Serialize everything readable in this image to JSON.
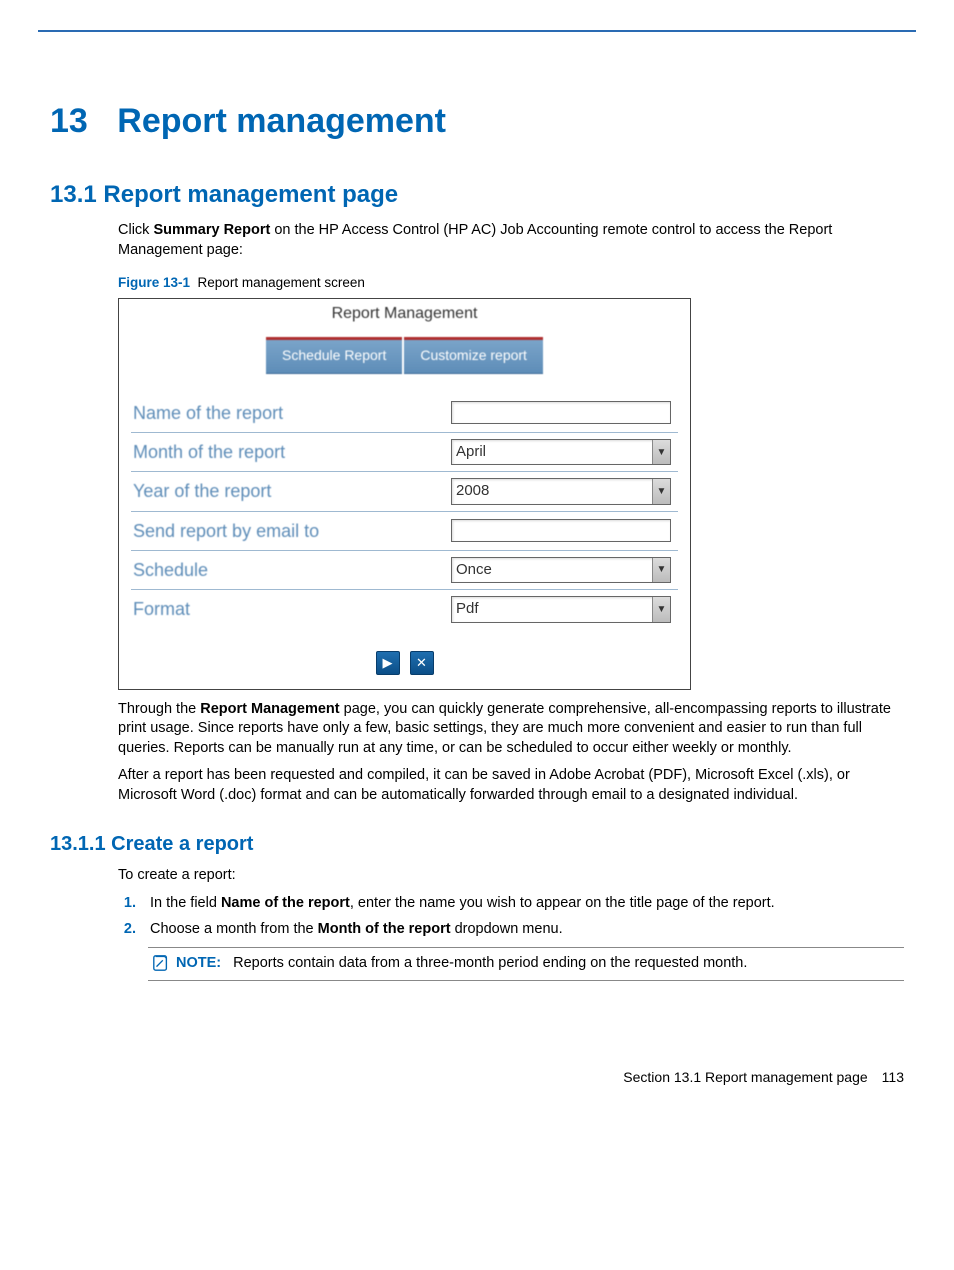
{
  "chapter": {
    "number": "13",
    "title": "Report management"
  },
  "section": {
    "number": "13.1",
    "title": "Report management page"
  },
  "intro": {
    "pre": "Click ",
    "bold": "Summary Report",
    "post": " on the HP Access Control (HP AC) Job Accounting remote control to access the Report Management page:"
  },
  "figure": {
    "label": "Figure 13-1",
    "caption": "Report management screen"
  },
  "screenshot": {
    "title": "Report Management",
    "tabs": {
      "schedule": "Schedule Report",
      "customize": "Customize report"
    },
    "rows": {
      "name_label": "Name of the report",
      "name_value": "",
      "month_label": "Month of the report",
      "month_value": "April",
      "year_label": "Year of the report",
      "year_value": "2008",
      "email_label": "Send report by email to",
      "email_value": "",
      "schedule_label": "Schedule",
      "schedule_value": "Once",
      "format_label": "Format",
      "format_value": "Pdf"
    }
  },
  "paras": {
    "p1_pre": "Through the ",
    "p1_bold": "Report Management",
    "p1_post": " page, you can quickly generate comprehensive, all-encompassing reports to illustrate print usage. Since reports have only a few, basic settings, they are much more convenient and easier to run than full queries. Reports can be manually run at any time, or can be scheduled to occur either weekly or monthly.",
    "p2": "After a report has been requested and compiled, it can be saved in Adobe Acrobat (PDF), Microsoft Excel (.xls), or Microsoft Word (.doc) format and can be automatically forwarded through email to a designated individual."
  },
  "subsection": {
    "number": "13.1.1",
    "title": "Create a report"
  },
  "create_intro": "To create a report:",
  "steps": {
    "s1_pre": "In the field ",
    "s1_bold": "Name of the report",
    "s1_post": ", enter the name you wish to appear on the title page of the report.",
    "s2_pre": "Choose a month from the ",
    "s2_bold": "Month of the report",
    "s2_post": " dropdown menu."
  },
  "note": {
    "label": "NOTE:",
    "text": "Reports contain data from a three-month period ending on the requested month."
  },
  "page_footer": {
    "section_label": "Section 13.1   Report management page",
    "page_number": "113"
  }
}
